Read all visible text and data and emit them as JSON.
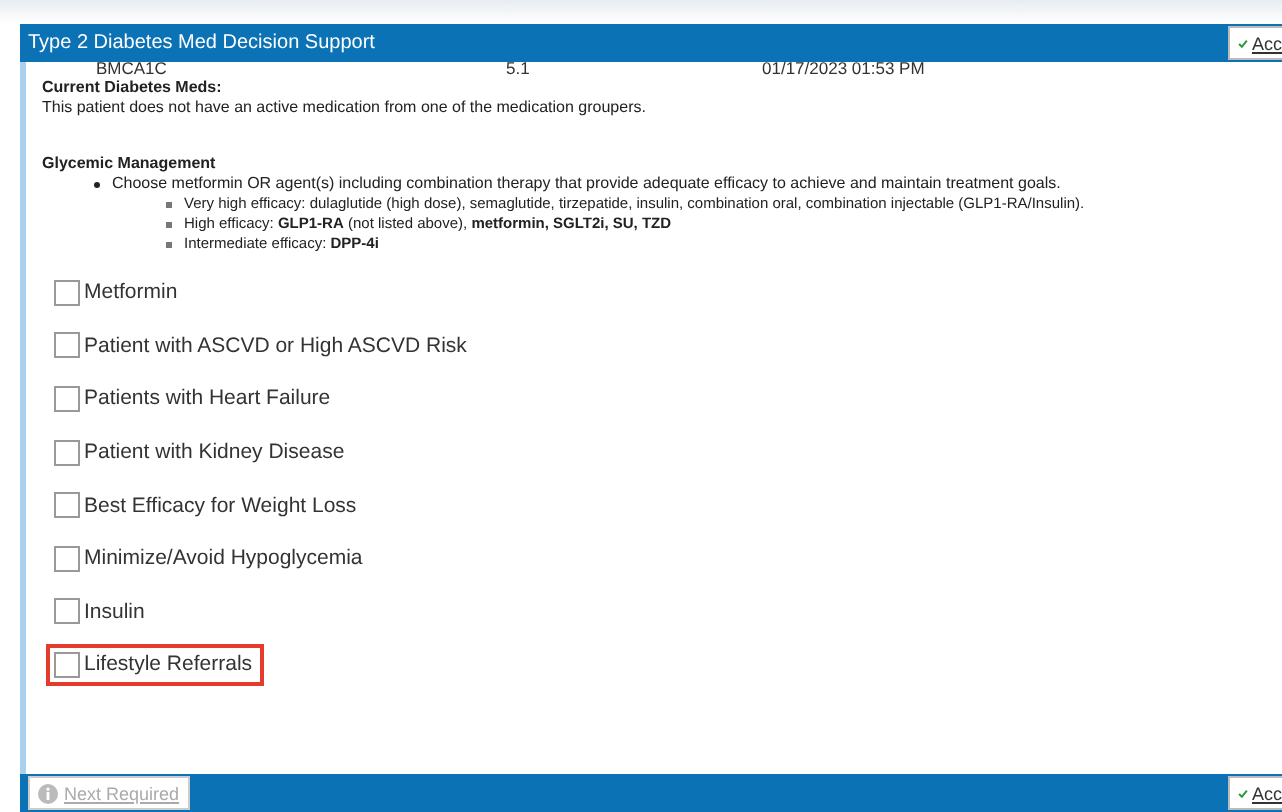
{
  "window": {
    "title": "Type 2 Diabetes Med Decision Support",
    "accept_label": "Acc"
  },
  "lab_row": [
    "BMCA1C",
    "5.1",
    "01/17/2023 01:53 PM"
  ],
  "current_meds": {
    "heading": "Current Diabetes Meds:",
    "text": "This patient does not have an active medication from one of the medication groupers."
  },
  "glycemic": {
    "heading": "Glycemic Management",
    "bullet": "Choose metformin OR agent(s) including combination therapy that provide adequate efficacy to achieve and maintain treatment goals.",
    "sub_bullets": [
      "Very high efficacy: dulaglutide (high dose), semaglutide, tirzepatide, insulin, combination oral, combination injectable (GLP1-RA/Insulin).",
      "High efficacy: **GLP1-RA** (not listed above), **metformin, SGLT2i, SU, TZD**",
      "Intermediate efficacy: **DPP-4i**"
    ]
  },
  "options": [
    {
      "label": "Metformin",
      "checked": false,
      "highlighted": false
    },
    {
      "label": "Patient with ASCVD or High ASCVD Risk",
      "checked": false,
      "highlighted": false
    },
    {
      "label": "Patients with Heart Failure",
      "checked": false,
      "highlighted": false
    },
    {
      "label": "Patient with Kidney Disease",
      "checked": false,
      "highlighted": false
    },
    {
      "label": "Best Efficacy for Weight Loss",
      "checked": false,
      "highlighted": false
    },
    {
      "label": "Minimize/Avoid Hypoglycemia",
      "checked": false,
      "highlighted": false
    },
    {
      "label": "Insulin",
      "checked": false,
      "highlighted": false
    },
    {
      "label": "Lifestyle Referrals",
      "checked": false,
      "highlighted": true
    }
  ],
  "footer": {
    "next_label": "Next Required",
    "next_disabled": true,
    "accept_label": "Acc"
  }
}
